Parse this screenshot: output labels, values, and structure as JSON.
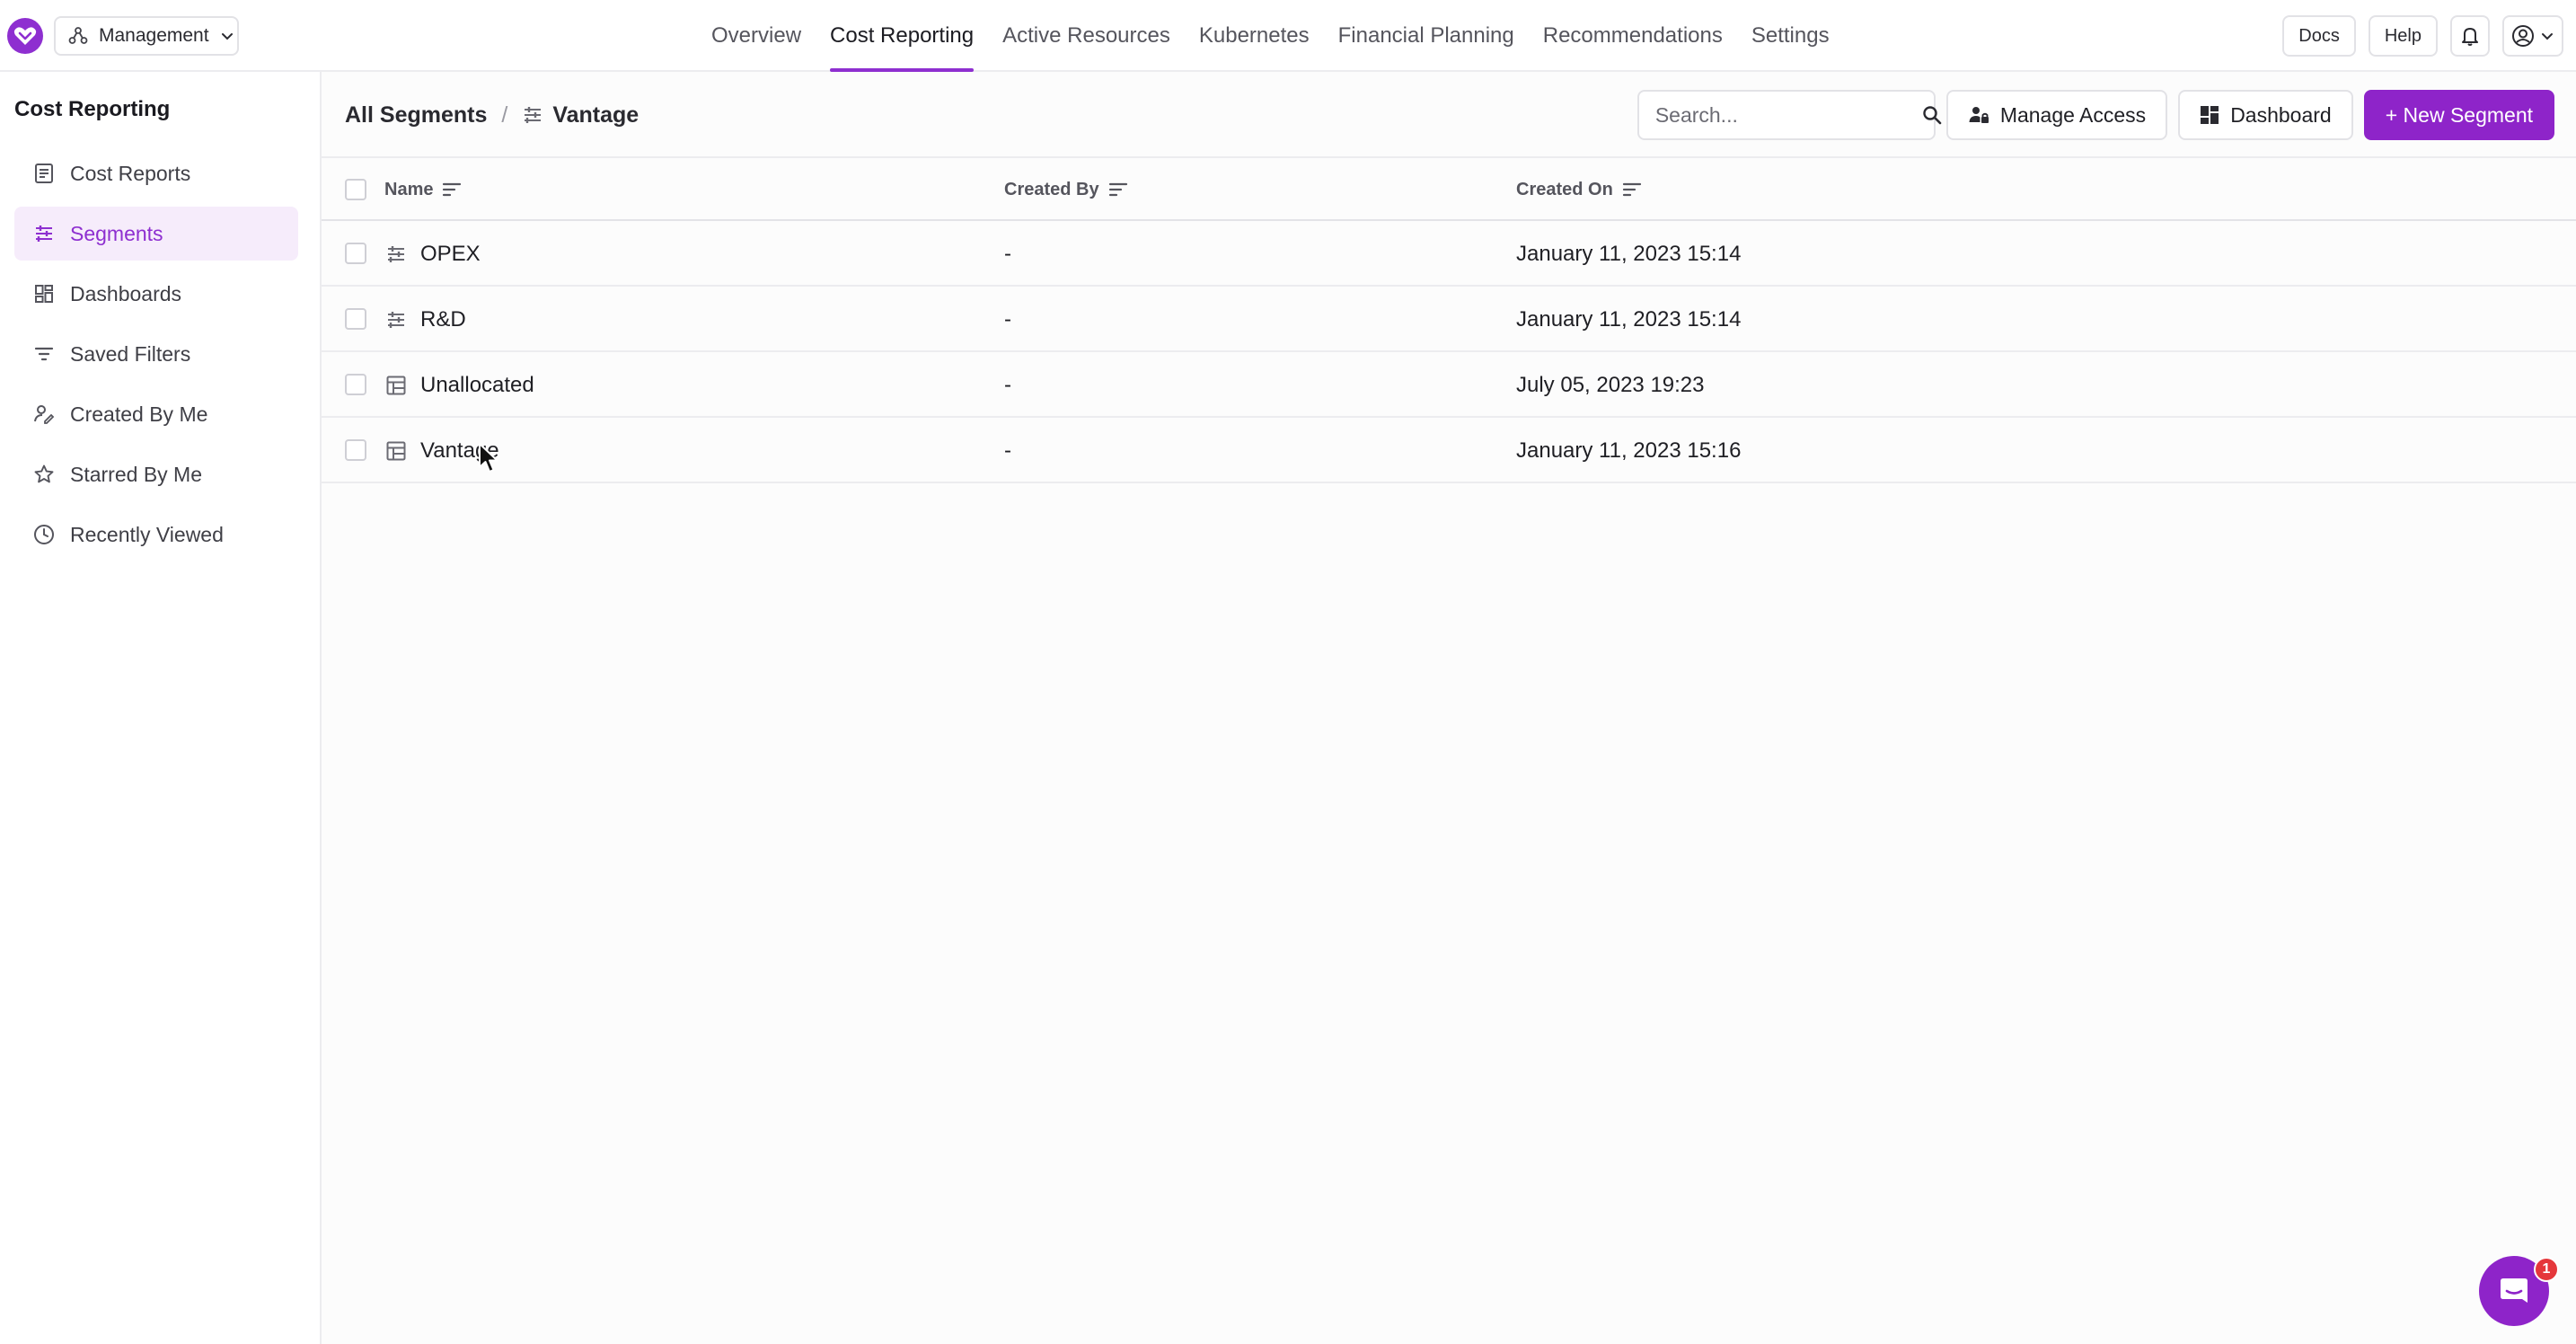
{
  "workspace": {
    "label": "Management"
  },
  "nav": {
    "tabs": [
      {
        "label": "Overview",
        "active": false
      },
      {
        "label": "Cost Reporting",
        "active": true
      },
      {
        "label": "Active Resources",
        "active": false
      },
      {
        "label": "Kubernetes",
        "active": false
      },
      {
        "label": "Financial Planning",
        "active": false
      },
      {
        "label": "Recommendations",
        "active": false
      },
      {
        "label": "Settings",
        "active": false
      }
    ],
    "docs_label": "Docs",
    "help_label": "Help"
  },
  "sidebar": {
    "title": "Cost Reporting",
    "items": [
      {
        "label": "Cost Reports",
        "icon": "report-icon",
        "active": false
      },
      {
        "label": "Segments",
        "icon": "segments-icon",
        "active": true
      },
      {
        "label": "Dashboards",
        "icon": "dashboard-grid-icon",
        "active": false
      },
      {
        "label": "Saved Filters",
        "icon": "filter-icon",
        "active": false
      },
      {
        "label": "Created By Me",
        "icon": "user-edit-icon",
        "active": false
      },
      {
        "label": "Starred By Me",
        "icon": "star-icon",
        "active": false
      },
      {
        "label": "Recently Viewed",
        "icon": "clock-icon",
        "active": false
      }
    ]
  },
  "header": {
    "breadcrumb_root": "All Segments",
    "breadcrumb_sep": "/",
    "breadcrumb_current": "Vantage",
    "search_placeholder": "Search...",
    "manage_access_label": "Manage Access",
    "dashboard_label": "Dashboard",
    "new_segment_label": "+ New Segment"
  },
  "table": {
    "columns": {
      "name": "Name",
      "created_by": "Created By",
      "created_on": "Created On"
    },
    "rows": [
      {
        "name": "OPEX",
        "icon": "segments-icon",
        "created_by": "-",
        "created_on": "January 11, 2023 15:14"
      },
      {
        "name": "R&D",
        "icon": "segments-icon",
        "created_by": "-",
        "created_on": "January 11, 2023 15:14"
      },
      {
        "name": "Unallocated",
        "icon": "table-icon",
        "created_by": "-",
        "created_on": "July 05, 2023 19:23"
      },
      {
        "name": "Vantage",
        "icon": "table-icon",
        "created_by": "-",
        "created_on": "January 11, 2023 15:16"
      }
    ]
  },
  "chat": {
    "badge_count": "1"
  },
  "colors": {
    "accent": "#8e24c9",
    "active_bg": "#f6ecfb",
    "badge": "#e5373b"
  }
}
